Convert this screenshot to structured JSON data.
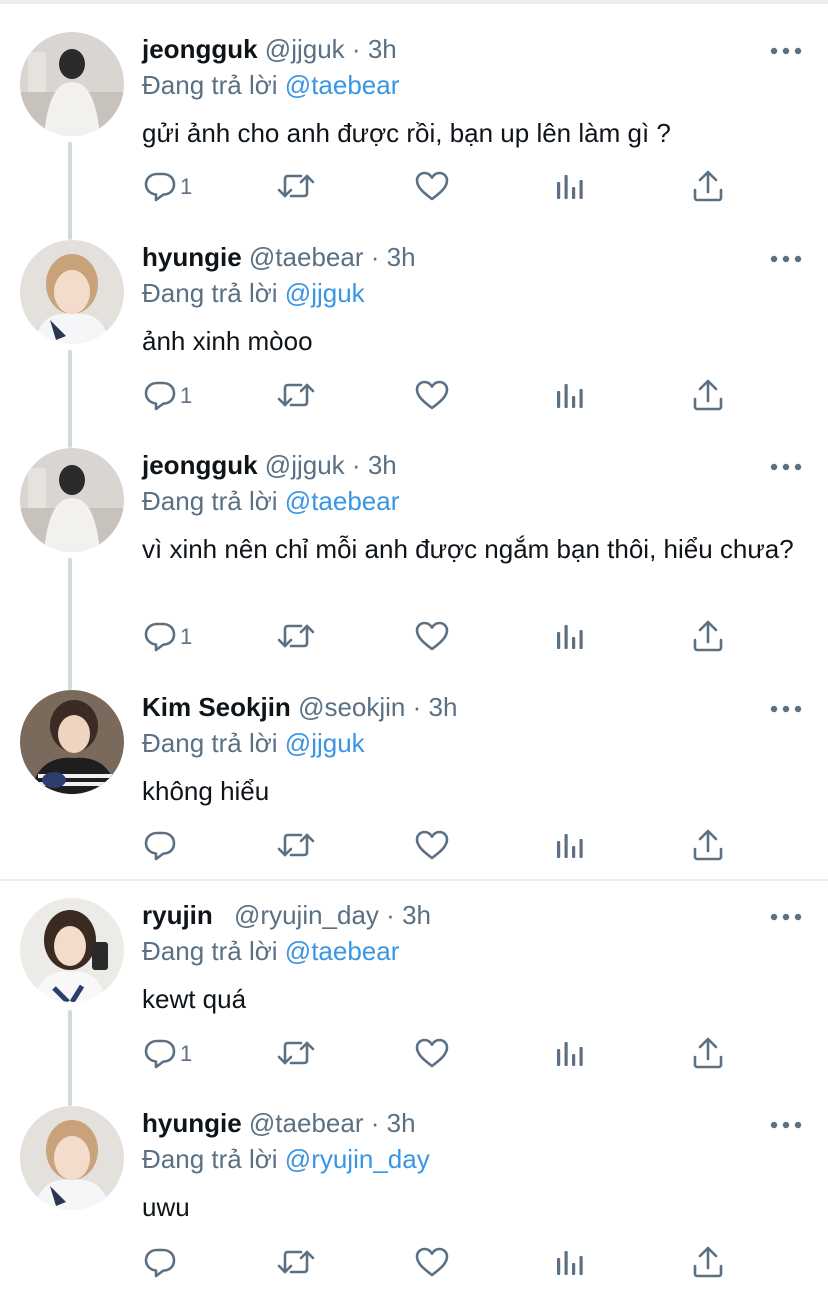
{
  "tweets": [
    {
      "name": "jeongguk",
      "handle": "@jjguk",
      "dot": "·",
      "time": "3h",
      "replying_label": "Đang trả lời",
      "replying_to": "@taebear",
      "text": "gửi ảnh cho anh được rồi, bạn up lên làm gì ?",
      "reply_count": "1",
      "avatar": "jeongguk-avatar"
    },
    {
      "name": "hyungie",
      "handle": "@taebear",
      "dot": "·",
      "time": "3h",
      "replying_label": "Đang trả lời",
      "replying_to": "@jjguk",
      "text": "ảnh xinh mòoo",
      "reply_count": "1",
      "avatar": "hyungie-avatar"
    },
    {
      "name": "jeongguk",
      "handle": "@jjguk",
      "dot": "·",
      "time": "3h",
      "replying_label": "Đang trả lời",
      "replying_to": "@taebear",
      "text": "vì xinh nên chỉ mỗi anh được ngắm bạn thôi, hiểu chưa?",
      "reply_count": "1",
      "avatar": "jeongguk-avatar"
    },
    {
      "name": "Kim Seokjin",
      "handle": "@seokjin",
      "dot": "·",
      "time": "3h",
      "replying_label": "Đang trả lời",
      "replying_to": "@jjguk",
      "text": "không hiểu",
      "reply_count": "",
      "avatar": "seokjin-avatar"
    },
    {
      "name": "ryujin",
      "handle": "@ryujin_day",
      "dot": "·",
      "time": "3h",
      "replying_label": "Đang trả lời",
      "replying_to": "@taebear",
      "text": "kewt quá",
      "reply_count": "1",
      "avatar": "ryujin-avatar"
    },
    {
      "name": "hyungie",
      "handle": "@taebear",
      "dot": "·",
      "time": "3h",
      "replying_label": "Đang trả lời",
      "replying_to": "@ryujin_day",
      "text": "uwu",
      "reply_count": "",
      "avatar": "hyungie-avatar"
    }
  ],
  "icons": {
    "reply": "reply-icon",
    "retweet": "retweet-icon",
    "like": "heart-icon",
    "analytics": "analytics-icon",
    "share": "share-icon",
    "more": "more-icon"
  },
  "colors": {
    "mention": "#3a95e3",
    "muted": "#5b7083",
    "text": "#0f1419",
    "thread_line": "#cfd9de"
  }
}
